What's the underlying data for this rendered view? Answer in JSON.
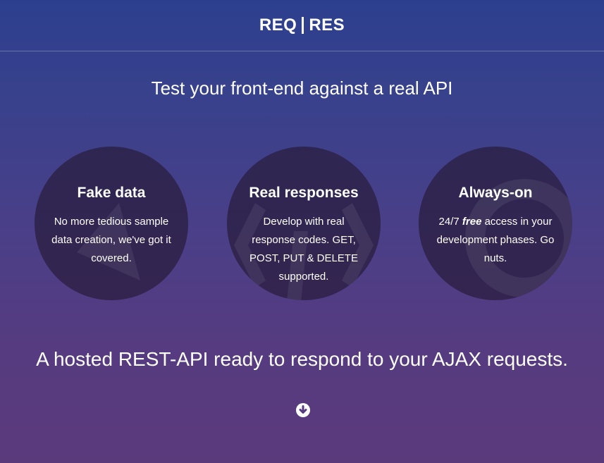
{
  "header": {
    "logo_left": "REQ",
    "logo_right": "RES"
  },
  "hero": {
    "tagline": "Test your front-end against a real API",
    "headline": "A hosted REST-API ready to respond to your AJAX requests."
  },
  "features": [
    {
      "title": "Fake data",
      "text": "No more tedious sample data creation, we've got it covered.",
      "icon": "database-icon"
    },
    {
      "title": "Real responses",
      "text": "Develop with real response codes. GET, POST, PUT & DELETE supported.",
      "icon": "code-icon"
    },
    {
      "title": "Always-on",
      "text_before": "24/7 ",
      "text_emphasis": "free",
      "text_after": " access in your development phases. Go nuts.",
      "icon": "power-icon"
    }
  ],
  "scroll": {
    "icon": "arrow-down-circle-icon"
  },
  "colors": {
    "gradient_top": "#2c3f8f",
    "gradient_bottom": "#5b3a7c",
    "circle_bg": "#281c3c",
    "text": "#ffffff"
  }
}
